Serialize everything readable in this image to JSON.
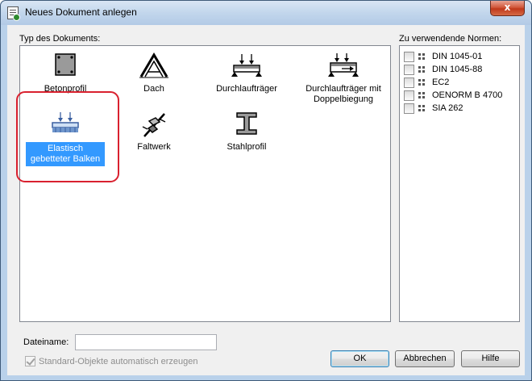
{
  "window": {
    "title": "Neues Dokument anlegen",
    "close_glyph": "x"
  },
  "document_types": {
    "label": "Typ des Dokuments:",
    "items": [
      {
        "caption": "Betonprofil",
        "icon": "concrete-profile-icon"
      },
      {
        "caption": "Dach",
        "icon": "roof-truss-icon"
      },
      {
        "caption": "Durchlaufträger",
        "icon": "continuous-beam-icon"
      },
      {
        "caption": "Durchlaufträger mit Doppelbiegung",
        "icon": "biaxial-beam-icon"
      },
      {
        "caption": "Elastisch gebetteter Balken",
        "icon": "elastic-foundation-beam-icon",
        "selected": true
      },
      {
        "caption": "Faltwerk",
        "icon": "folded-plate-icon"
      },
      {
        "caption": "Stahlprofil",
        "icon": "steel-profile-icon"
      }
    ]
  },
  "norms": {
    "label": "Zu verwendende Normen:",
    "items": [
      {
        "label": "DIN 1045-01",
        "checked": false
      },
      {
        "label": "DIN 1045-88",
        "checked": false
      },
      {
        "label": "EC2",
        "checked": false
      },
      {
        "label": "OENORM B 4700",
        "checked": false
      },
      {
        "label": "SIA 262",
        "checked": false
      }
    ]
  },
  "filename": {
    "label": "Dateiname:",
    "value": "",
    "placeholder": ""
  },
  "standard_objects": {
    "label": "Standard-Objekte automatisch erzeugen",
    "checked": true,
    "disabled": true
  },
  "buttons": {
    "ok": "OK",
    "cancel": "Abbrechen",
    "help": "Hilfe"
  },
  "colors": {
    "selection": "#3399ff",
    "highlight_ring": "#d9212f",
    "dialog_bg": "#f0f0f0"
  }
}
